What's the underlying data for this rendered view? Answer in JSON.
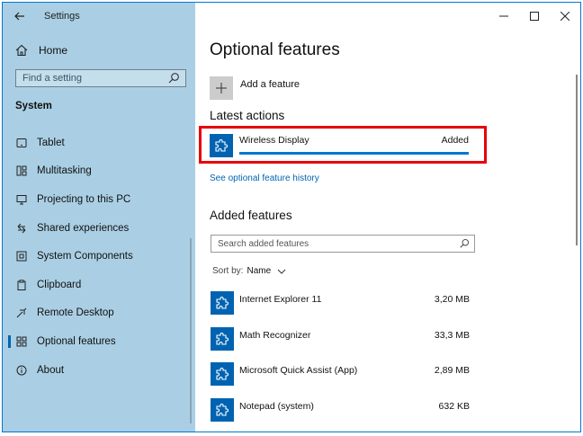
{
  "window": {
    "title": "Settings"
  },
  "sidebar": {
    "home_label": "Home",
    "search_placeholder": "Find a setting",
    "section": "System",
    "items": [
      {
        "label": "Tablet",
        "icon": "tablet-icon"
      },
      {
        "label": "Multitasking",
        "icon": "multitasking-icon"
      },
      {
        "label": "Projecting to this PC",
        "icon": "projecting-icon"
      },
      {
        "label": "Shared experiences",
        "icon": "shared-experiences-icon"
      },
      {
        "label": "System Components",
        "icon": "system-components-icon"
      },
      {
        "label": "Clipboard",
        "icon": "clipboard-icon"
      },
      {
        "label": "Remote Desktop",
        "icon": "remote-desktop-icon"
      },
      {
        "label": "Optional features",
        "icon": "optional-features-icon",
        "active": true
      },
      {
        "label": "About",
        "icon": "info-icon"
      }
    ]
  },
  "main": {
    "title": "Optional features",
    "add_feature_label": "Add a feature",
    "latest_actions_title": "Latest actions",
    "latest": {
      "name": "Wireless Display",
      "status": "Added",
      "progress": 1.0
    },
    "history_link": "See optional feature history",
    "added_features_title": "Added features",
    "search_placeholder": "Search added features",
    "sort_prefix": "Sort by:",
    "sort_value": "Name",
    "features": [
      {
        "name": "Internet Explorer 11",
        "size": "3,20 MB"
      },
      {
        "name": "Math Recognizer",
        "size": "33,3 MB"
      },
      {
        "name": "Microsoft Quick Assist (App)",
        "size": "2,89 MB"
      },
      {
        "name": "Notepad (system)",
        "size": "632 KB"
      }
    ]
  },
  "colors": {
    "accent": "#0078d4",
    "sidebar_bg": "#aacfe4",
    "highlight": "#e8000a"
  }
}
